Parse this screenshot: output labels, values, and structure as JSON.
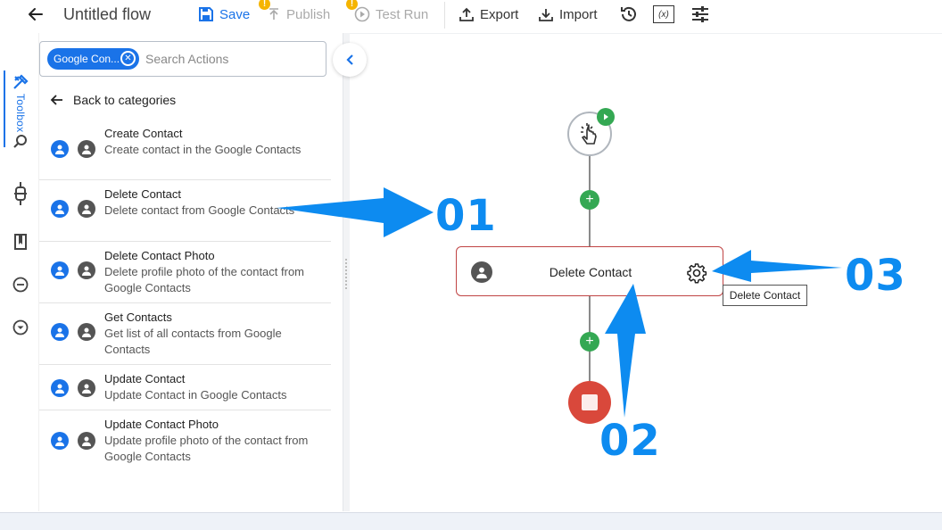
{
  "header": {
    "title": "Untitled flow",
    "save_label": "Save",
    "publish_label": "Publish",
    "testrun_label": "Test Run",
    "export_label": "Export",
    "import_label": "Import",
    "warning_badge": "!",
    "vars_icon_text": "(x)"
  },
  "rail": {
    "toolbox_label": "Toolbox"
  },
  "search": {
    "chip_label": "Google Con...",
    "placeholder": "Search Actions"
  },
  "panel": {
    "back_label": "Back to categories",
    "actions": [
      {
        "title": "Create Contact",
        "desc": "Create contact in the Google Contacts"
      },
      {
        "title": "Delete Contact",
        "desc": "Delete contact from Google Contacts"
      },
      {
        "title": "Delete Contact Photo",
        "desc": "Delete profile photo of the contact from Google Contacts"
      },
      {
        "title": "Get Contacts",
        "desc": "Get list of all contacts from Google Contacts"
      },
      {
        "title": "Update Contact",
        "desc": "Update Contact in Google Contacts"
      },
      {
        "title": "Update Contact Photo",
        "desc": "Update profile photo of the contact from Google Contacts"
      }
    ]
  },
  "flow": {
    "node_label": "Delete Contact",
    "tooltip": "Delete Contact",
    "plus_symbol": "+"
  },
  "annotations": {
    "a1": "01",
    "a2": "02",
    "a3": "03"
  },
  "colors": {
    "accent": "#1a73e8",
    "success": "#34a853",
    "danger": "#d9483b",
    "node_border": "#c04444",
    "annotation": "#0d8bf0"
  }
}
